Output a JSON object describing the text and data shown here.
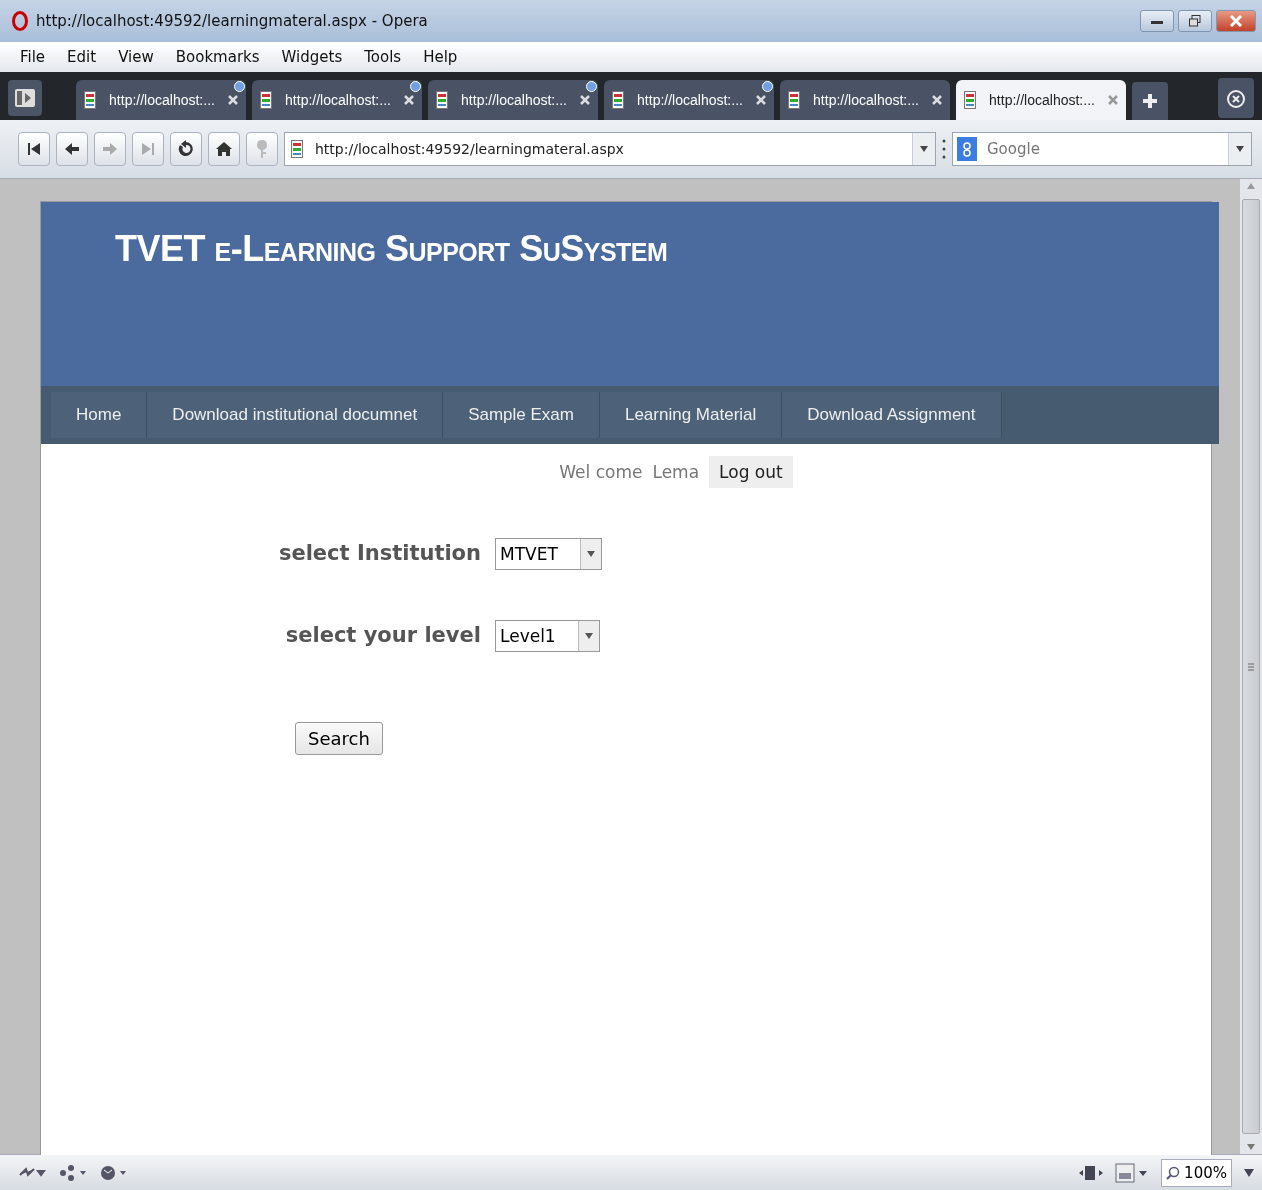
{
  "window": {
    "title": "http://localhost:49592/learningmateral.aspx - Opera"
  },
  "menu": [
    "File",
    "Edit",
    "View",
    "Bookmarks",
    "Widgets",
    "Tools",
    "Help"
  ],
  "tabs": [
    {
      "label": "http://localhost:...",
      "selected": false,
      "marked": true
    },
    {
      "label": "http://localhost:...",
      "selected": false,
      "marked": true
    },
    {
      "label": "http://localhost:...",
      "selected": false,
      "marked": true
    },
    {
      "label": "http://localhost:...",
      "selected": false,
      "marked": true
    },
    {
      "label": "http://localhost:...",
      "selected": false,
      "marked": false
    },
    {
      "label": "http://localhost:...",
      "selected": true,
      "marked": false
    }
  ],
  "address": {
    "value": "http://localhost:49592/learningmateral.aspx"
  },
  "search": {
    "placeholder": "Google"
  },
  "page": {
    "title": "TVET e-Learning Support SuSystem",
    "nav": [
      "Home",
      "Download institutional documnet",
      "Sample Exam",
      "Learning Material",
      "Download Assignment"
    ],
    "welcome": "Wel come",
    "user": "Lema",
    "logout": "Log out",
    "form": [
      {
        "label": "select Institution",
        "value": "MTVET"
      },
      {
        "label": "select your level",
        "value": "Level1"
      }
    ],
    "search_button": "Search"
  },
  "status_bar": {
    "zoom": "100%"
  }
}
